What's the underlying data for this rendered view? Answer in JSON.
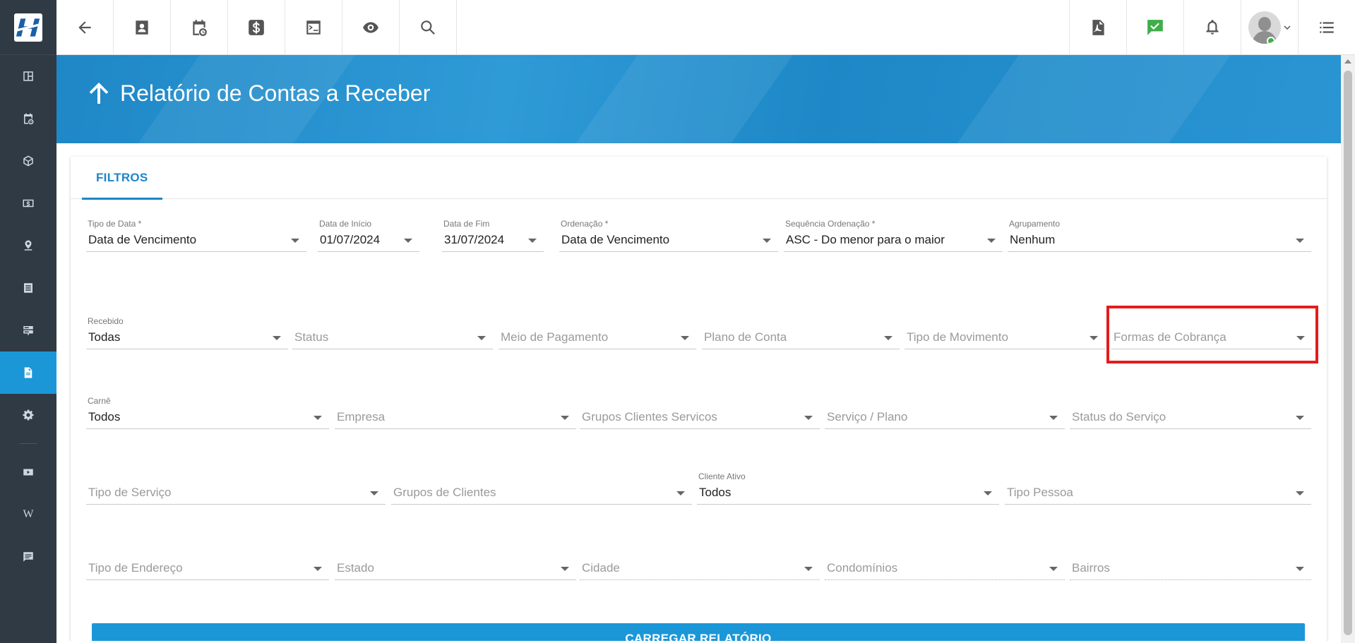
{
  "page": {
    "title": "Relatório de Contas a Receber"
  },
  "tabs": [
    {
      "label": "FILTROS"
    }
  ],
  "sidebar": {
    "items": [
      {
        "icon": "dashboard-icon"
      },
      {
        "icon": "calendar-clock-icon"
      },
      {
        "icon": "box-icon"
      },
      {
        "icon": "money-icon"
      },
      {
        "icon": "map-pin-icon"
      },
      {
        "icon": "list-icon"
      },
      {
        "icon": "server-icon"
      },
      {
        "icon": "document-icon",
        "active": true
      },
      {
        "icon": "gear-icon"
      },
      {
        "icon": "youtube-icon"
      },
      {
        "icon": "wikipedia-icon",
        "text": "W"
      },
      {
        "icon": "chat-icon"
      }
    ]
  },
  "topbar": {
    "left": [
      "back-arrow-icon",
      "contact-icon",
      "calendar-clock-icon",
      "dollar-icon",
      "terminal-icon",
      "eye-icon",
      "search-icon"
    ],
    "right": [
      "pdf-icon",
      "chat-check-icon",
      "bell-icon",
      "avatar",
      "menu-list-icon"
    ],
    "colors": {
      "chat_check": "#3fae49"
    }
  },
  "filters": {
    "row1": [
      {
        "label": "Tipo de Data *",
        "value": "Data de Vencimento"
      },
      {
        "label": "Data de Início",
        "value": "01/07/2024"
      },
      {
        "label": "Data de Fim",
        "value": "31/07/2024"
      },
      {
        "label": "Ordenação *",
        "value": "Data de Vencimento"
      },
      {
        "label": "Sequência Ordenação *",
        "value": "ASC - Do menor para o maior"
      },
      {
        "label": "Agrupamento",
        "value": "Nenhum"
      }
    ],
    "row2": [
      {
        "label": "Recebido",
        "value": "Todas"
      },
      {
        "placeholder": "Status"
      },
      {
        "placeholder": "Meio de Pagamento"
      },
      {
        "placeholder": "Plano de Conta"
      },
      {
        "placeholder": "Tipo de Movimento"
      },
      {
        "placeholder": "Formas de Cobrança"
      }
    ],
    "row3": [
      {
        "label": "Carnê",
        "value": "Todos"
      },
      {
        "placeholder": "Empresa"
      },
      {
        "placeholder": "Grupos Clientes Servicos"
      },
      {
        "placeholder": "Serviço / Plano"
      },
      {
        "placeholder": "Status do Serviço"
      }
    ],
    "row4": [
      {
        "placeholder": "Tipo de Serviço"
      },
      {
        "placeholder": "Grupos de Clientes"
      },
      {
        "label": "Cliente Ativo",
        "value": "Todos"
      },
      {
        "placeholder": "Tipo Pessoa"
      }
    ],
    "row5": [
      {
        "placeholder": "Tipo de Endereço"
      },
      {
        "placeholder": "Estado"
      },
      {
        "placeholder": "Cidade"
      },
      {
        "placeholder": "Condomínios"
      },
      {
        "placeholder": "Bairros"
      }
    ]
  },
  "actions": {
    "load_label": "CARREGAR RELATÓRIO"
  },
  "colors": {
    "primary": "#1b97d8",
    "sidebar": "#2f3a45",
    "highlight": "#e41c1c"
  }
}
